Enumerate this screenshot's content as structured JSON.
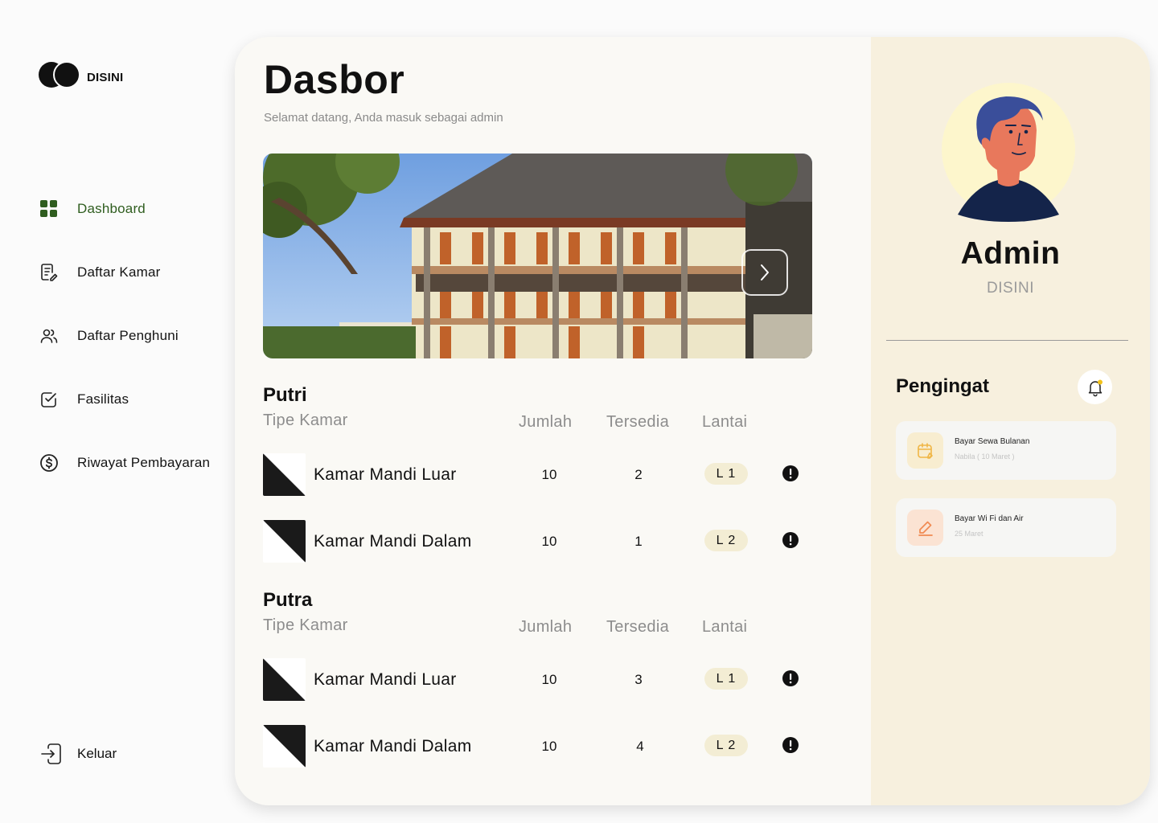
{
  "brand": {
    "name": "DISINI"
  },
  "sidebar": {
    "items": [
      {
        "label": "Dashboard",
        "icon": "grid-icon",
        "active": true
      },
      {
        "label": "Daftar Kamar",
        "icon": "document-edit-icon",
        "active": false
      },
      {
        "label": "Daftar Penghuni",
        "icon": "users-icon",
        "active": false
      },
      {
        "label": "Fasilitas",
        "icon": "check-square-icon",
        "active": false
      },
      {
        "label": "Riwayat Pembayaran",
        "icon": "dollar-circle-icon",
        "active": false
      }
    ],
    "logout": {
      "label": "Keluar",
      "icon": "logout-icon"
    }
  },
  "main": {
    "title": "Dasbor",
    "subtitle": "Selamat datang, Anda masuk sebagai admin",
    "columns": {
      "type": "Tipe Kamar",
      "count": "Jumlah",
      "available": "Tersedia",
      "floor": "Lantai"
    },
    "sections": [
      {
        "title": "Putri",
        "rows": [
          {
            "name": "Kamar Mandi Luar",
            "jumlah": "10",
            "tersedia": "2",
            "lantai": "L 1"
          },
          {
            "name": "Kamar Mandi Dalam",
            "jumlah": "10",
            "tersedia": "1",
            "lantai": "L 2"
          }
        ]
      },
      {
        "title": "Putra",
        "rows": [
          {
            "name": "Kamar Mandi Luar",
            "jumlah": "10",
            "tersedia": "3",
            "lantai": "L 1"
          },
          {
            "name": "Kamar Mandi Dalam",
            "jumlah": "10",
            "tersedia": "4",
            "lantai": "L 2"
          }
        ]
      }
    ]
  },
  "profile": {
    "name": "Admin",
    "org": "DISINI"
  },
  "reminders": {
    "title": "Pengingat",
    "items": [
      {
        "title": "Bayar Sewa Bulanan",
        "sub": "Nabila ( 10 Maret )",
        "icon": "calendar-edit-icon",
        "color": "#f8edd0"
      },
      {
        "title": "Bayar Wi Fi dan Air",
        "sub": "25 Maret",
        "icon": "pencil-icon",
        "color": "#fbe3d3"
      }
    ]
  },
  "colors": {
    "accent_green": "#2f5d1f",
    "panel_beige": "#f7f0de",
    "badge": "#f3edd4"
  }
}
